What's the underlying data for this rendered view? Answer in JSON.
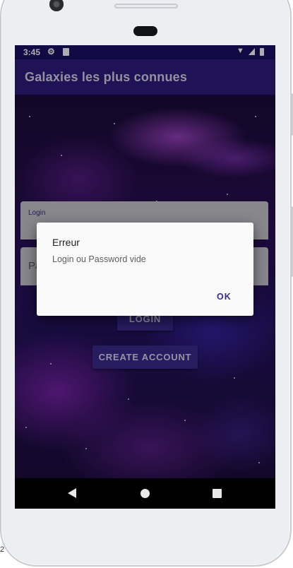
{
  "status_bar": {
    "time": "3:45"
  },
  "app_bar": {
    "title": "Galaxies les plus connues"
  },
  "form": {
    "login_label": "Login",
    "password_placeholder": "Pa"
  },
  "buttons": {
    "login_label": "LOGIN",
    "create_account_label": "CREATE ACCOUNT"
  },
  "dialog": {
    "title": "Erreur",
    "message": "Login ou Password vide",
    "ok_label": "OK"
  },
  "edge_marks": {
    "bottom_left": "2"
  },
  "colors": {
    "status_bar": "#1b0f66",
    "app_bar": "#2e1c7e",
    "button": "#3a2a8e",
    "accent": "#3a2a8e",
    "field": "#c9c7cf",
    "dialog": "#fafafa"
  },
  "icons": {
    "status_left": [
      "gear-icon",
      "sd-card-icon"
    ],
    "status_right": [
      "wifi-icon",
      "signal-icon",
      "battery-icon"
    ],
    "navigation": [
      "back-icon",
      "home-icon",
      "recents-icon"
    ]
  }
}
